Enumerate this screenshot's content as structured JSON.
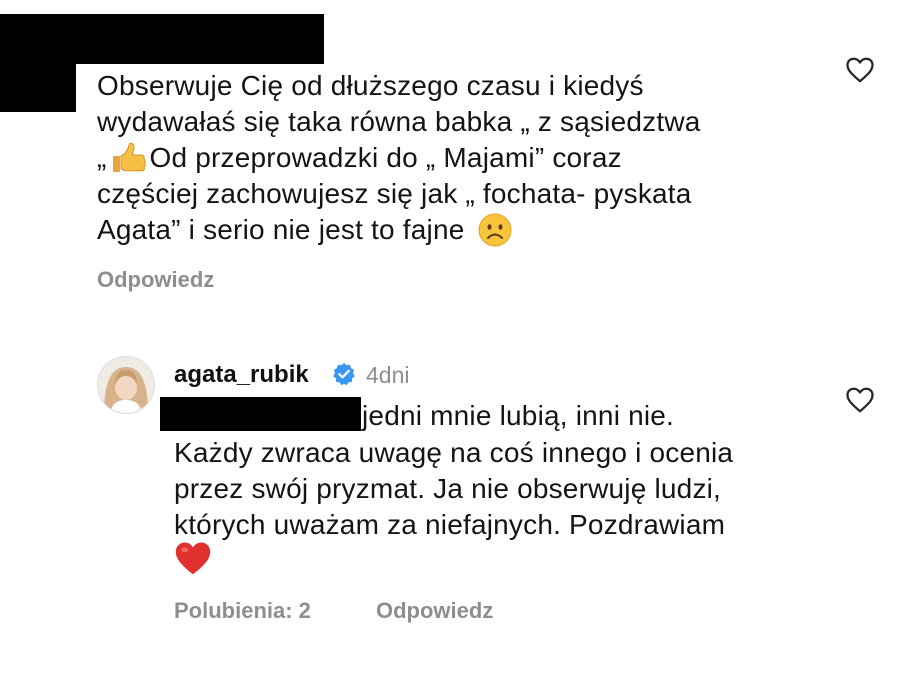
{
  "comment1": {
    "lines": [
      "Obserwuje Cię od dłuższego czasu i kiedyś",
      "wydawałaś się taka równa babka „ z sąsiedztwa",
      "„",
      "Od przeprowadzki do „ Majami” coraz",
      "częściej zachowujesz się jak „ fochata- pyskata",
      "Agata” i serio nie jest to fajne"
    ],
    "reply_label": "Odpowiedz",
    "thumbs_emoji": "thumbs-up-emoji",
    "sad_emoji": "frowning-face-emoji"
  },
  "reply": {
    "username": "agata_rubik",
    "time": "4dni",
    "lines": [
      "jedni mnie lubią, inni nie.",
      "Każdy zwraca uwagę na coś innego i ocenia",
      "przez swój pryzmat. Ja nie obserwuję ludzi,",
      "których uważam za niefajnych. Pozdrawiam"
    ],
    "heart_emoji": "red-heart-emoji",
    "likes_label": "Polubienia: 2",
    "reply_label": "Odpowiedz"
  },
  "colors": {
    "muted": "#8e8e8e",
    "verified": "#3897f0",
    "heart": "#e0312d"
  }
}
